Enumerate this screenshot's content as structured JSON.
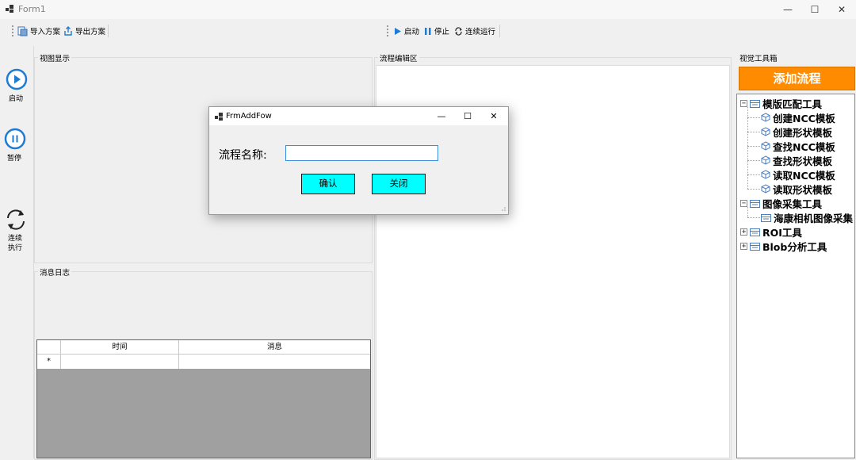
{
  "window": {
    "title": "Form1",
    "minimize": "—",
    "maximize": "☐",
    "close": "✕"
  },
  "toolbar": {
    "left": [
      {
        "label": "导入方案",
        "icon": "import-icon"
      },
      {
        "label": "导出方案",
        "icon": "export-icon"
      }
    ],
    "center": [
      {
        "label": "启动",
        "icon": "play-icon"
      },
      {
        "label": "停止",
        "icon": "pause-icon"
      },
      {
        "label": "连续运行",
        "icon": "loop-icon"
      }
    ]
  },
  "leftrail": {
    "start_label": "启动",
    "pause_label": "暂停",
    "continuous_label_1": "连续",
    "continuous_label_2": "执行"
  },
  "panels": {
    "view_display": "视图显示",
    "message_log": "消息日志",
    "flow_edit": "流程编辑区",
    "vision_toolbox": "视觉工具箱"
  },
  "grid": {
    "columns": [
      "时间",
      "消息"
    ],
    "new_row_marker": "*"
  },
  "right": {
    "add_flow_button": "添加流程",
    "tree": [
      {
        "label": "模版匹配工具",
        "level": 0,
        "expanded": true,
        "children": [
          {
            "label": "创建NCC模板"
          },
          {
            "label": "创建形状模板"
          },
          {
            "label": "查找NCC模板"
          },
          {
            "label": "查找形状模板"
          },
          {
            "label": "读取NCC模板"
          },
          {
            "label": "读取形状模板"
          }
        ]
      },
      {
        "label": "图像采集工具",
        "level": 0,
        "expanded": true,
        "children": [
          {
            "label": "海康相机图像采集"
          }
        ]
      },
      {
        "label": "ROI工具",
        "level": 0,
        "expanded": false,
        "children": []
      },
      {
        "label": "Blob分析工具",
        "level": 0,
        "expanded": false,
        "children": []
      }
    ]
  },
  "dialog": {
    "title": "FrmAddFow",
    "field_label": "流程名称:",
    "field_value": "",
    "confirm": "确认",
    "close": "关闭",
    "minimize": "—",
    "maximize": "☐",
    "close_x": "✕"
  },
  "colors": {
    "accent_blue": "#1e7bd2",
    "add_flow_orange": "#ff8c00",
    "dialog_button_cyan": "#00ffff",
    "grid_empty_gray": "#a0a0a0"
  }
}
